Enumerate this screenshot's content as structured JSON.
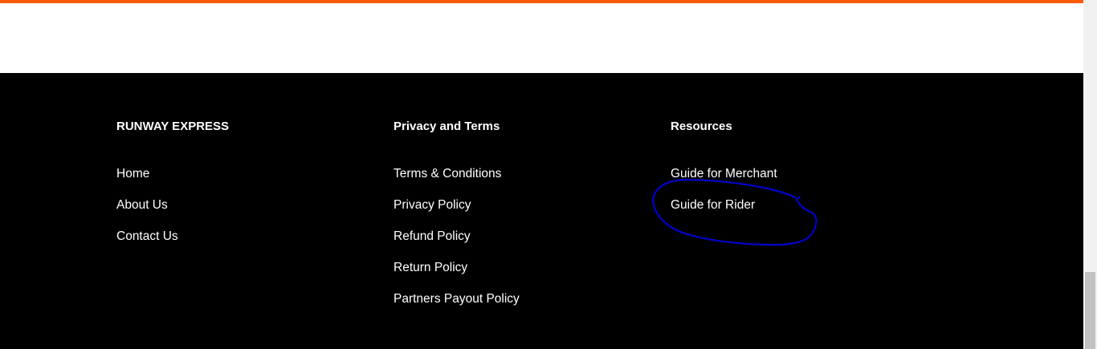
{
  "colors": {
    "accent": "#ff5a00",
    "footer_background": "#000000",
    "footer_text": "#ffffff",
    "annotation_stroke": "#0000cc"
  },
  "footer": {
    "columns": [
      {
        "heading": "RUNWAY EXPRESS",
        "links": [
          "Home",
          "About Us",
          "Contact Us"
        ]
      },
      {
        "heading": "Privacy and Terms",
        "links": [
          "Terms & Conditions",
          "Privacy Policy",
          "Refund Policy",
          "Return Policy",
          "Partners Payout Policy"
        ]
      },
      {
        "heading": "Resources",
        "links": [
          "Guide for Merchant",
          "Guide for Rider"
        ]
      }
    ]
  },
  "annotation": {
    "shape": "hand-drawn ellipse",
    "target": "Guide for Rider"
  }
}
